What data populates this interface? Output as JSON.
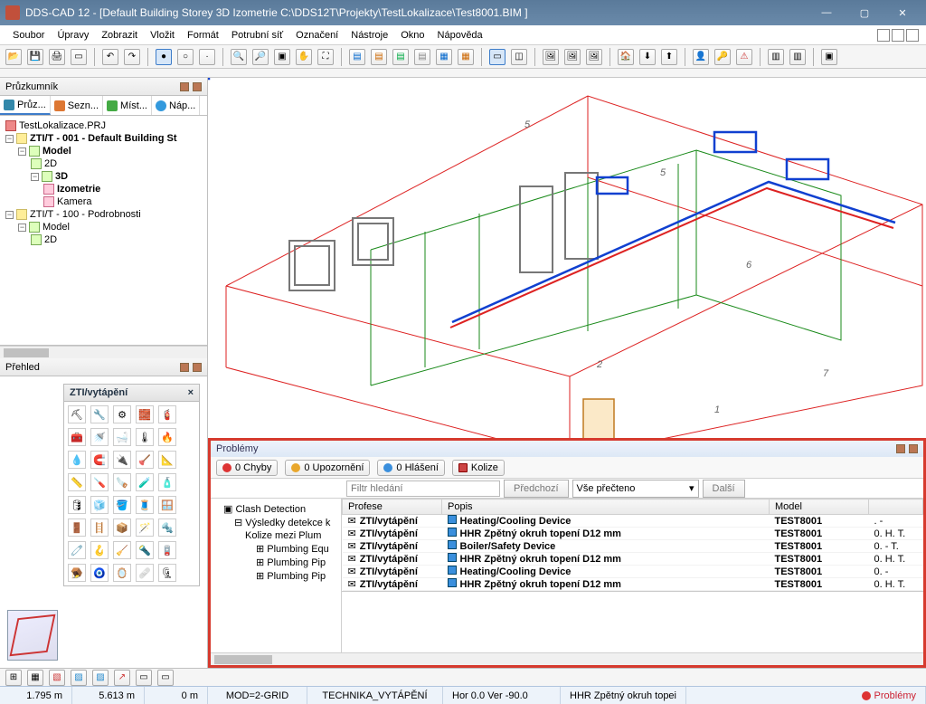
{
  "title": "DDS-CAD 12 - [Default Building Storey  3D  Izometrie  C:\\DDS12T\\Projekty\\TestLokalizace\\Test8001.BIM ]",
  "menu": [
    "Soubor",
    "Úpravy",
    "Zobrazit",
    "Vložit",
    "Formát",
    "Potrubní síť",
    "Označení",
    "Nástroje",
    "Okno",
    "Nápověda"
  ],
  "explorer": {
    "title": "Průzkumník",
    "tabs": [
      {
        "label": "Průz...",
        "active": true
      },
      {
        "label": "Sezn..."
      },
      {
        "label": "Míst..."
      },
      {
        "label": "Náp..."
      }
    ],
    "tree": {
      "project": "TestLokalizace.PRJ",
      "items": [
        {
          "label": "ZTI/T - 001 - Default Building St",
          "bold": true,
          "children": [
            {
              "label": "Model",
              "bold": true,
              "children": [
                {
                  "label": "2D"
                },
                {
                  "label": "3D",
                  "bold": true,
                  "children": [
                    {
                      "label": "Izometrie",
                      "bold": true
                    },
                    {
                      "label": "Kamera"
                    }
                  ]
                }
              ]
            }
          ]
        },
        {
          "label": "ZTI/T - 100 - Podrobnosti",
          "children": [
            {
              "label": "Model",
              "children": [
                {
                  "label": "2D"
                }
              ]
            }
          ]
        }
      ]
    }
  },
  "overview": {
    "title": "Přehled",
    "palette_title": "ZTI/vytápění"
  },
  "problems": {
    "title": "Problémy",
    "tabs": {
      "errors": "0 Chyby",
      "warnings": "0 Upozornění",
      "info": "0 Hlášení",
      "collisions": "Kolize"
    },
    "filter_placeholder": "Filtr hledání",
    "prev": "Předchozí",
    "read_all": "Vše přečteno",
    "next": "Další",
    "tree": {
      "root": "Clash Detection",
      "c1": "Výsledky detekce k",
      "c2": "Kolize mezi Plum",
      "c3": "Plumbing Equ",
      "c4": "Plumbing Pip",
      "c5": "Plumbing Pip"
    },
    "cols": {
      "profese": "Profese",
      "popis": "Popis",
      "model": "Model"
    },
    "rows": [
      {
        "prof": "ZTI/vytápění",
        "popis": "Heating/Cooling Device",
        "model": "TEST8001",
        "ext": ".  -"
      },
      {
        "prof": "ZTI/vytápění",
        "popis": "HHR Zpětný okruh topení D12 mm",
        "model": "TEST8001",
        "ext": "0. H. T."
      },
      {
        "prof": "ZTI/vytápění",
        "popis": "Boiler/Safety Device",
        "model": "TEST8001",
        "ext": "0.  -  T."
      },
      {
        "prof": "ZTI/vytápění",
        "popis": "HHR Zpětný okruh topení D12 mm",
        "model": "TEST8001",
        "ext": "0. H. T."
      },
      {
        "prof": "ZTI/vytápění",
        "popis": "Heating/Cooling Device",
        "model": "TEST8001",
        "ext": "0.  -"
      },
      {
        "prof": "ZTI/vytápění",
        "popis": "HHR Zpětný okruh topení D12 mm",
        "model": "TEST8001",
        "ext": "0. H. T."
      }
    ]
  },
  "status": {
    "x": "1.795 m",
    "y": "5.613 m",
    "z": "0 m",
    "mod": "MOD=2-GRID",
    "layer": "TECHNIKA_VYTÁPĚNÍ",
    "hor": "Hor  0.0 Ver -90.0",
    "extra": "HHR Zpětný okruh topei",
    "problems": "Problémy"
  }
}
